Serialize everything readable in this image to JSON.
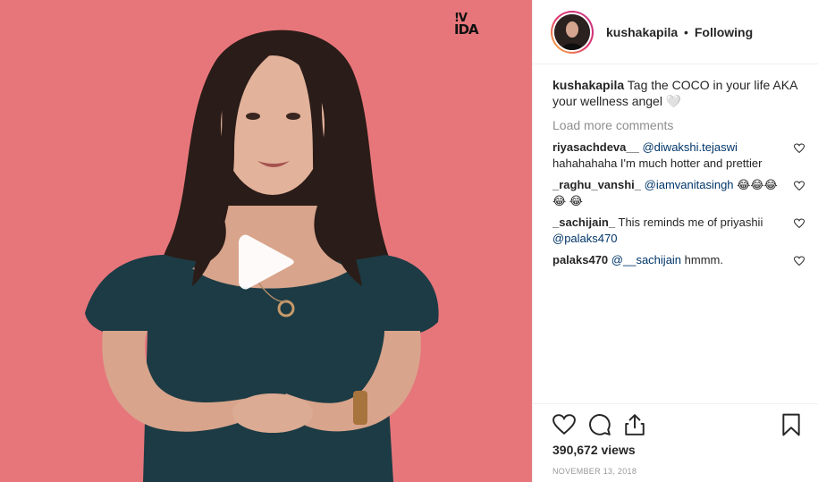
{
  "media": {
    "brand_logo_top": "!V",
    "brand_logo_bottom": "IDA",
    "background_color": "#e7767b"
  },
  "header": {
    "username": "kushakapila",
    "separator": "•",
    "follow_status": "Following"
  },
  "caption": {
    "username": "kushakapila",
    "text": "Tag the COCO in your life AKA your wellness angel 🤍"
  },
  "load_more": "Load more comments",
  "comments": [
    {
      "username": "riyasachdeva__",
      "mention": "@diwakshi.tejaswi",
      "text": "hahahahaha I'm much hotter and prettier"
    },
    {
      "username": "_raghu_vanshi_",
      "mention": "@iamvanitasingh",
      "text": "😂😂😂😂 😂"
    },
    {
      "username": "_sachijain_",
      "mention": "",
      "text": "This reminds me of priyashii",
      "trailing_mention": "@palaks470"
    },
    {
      "username": "palaks470",
      "mention": "@__sachijain",
      "text": "hmmm."
    }
  ],
  "actions": {
    "views": "390,672 views",
    "date": "NOVEMBER 13, 2018"
  },
  "icons": [
    "play-icon",
    "heart-icon",
    "comment-icon",
    "share-icon",
    "bookmark-icon"
  ]
}
